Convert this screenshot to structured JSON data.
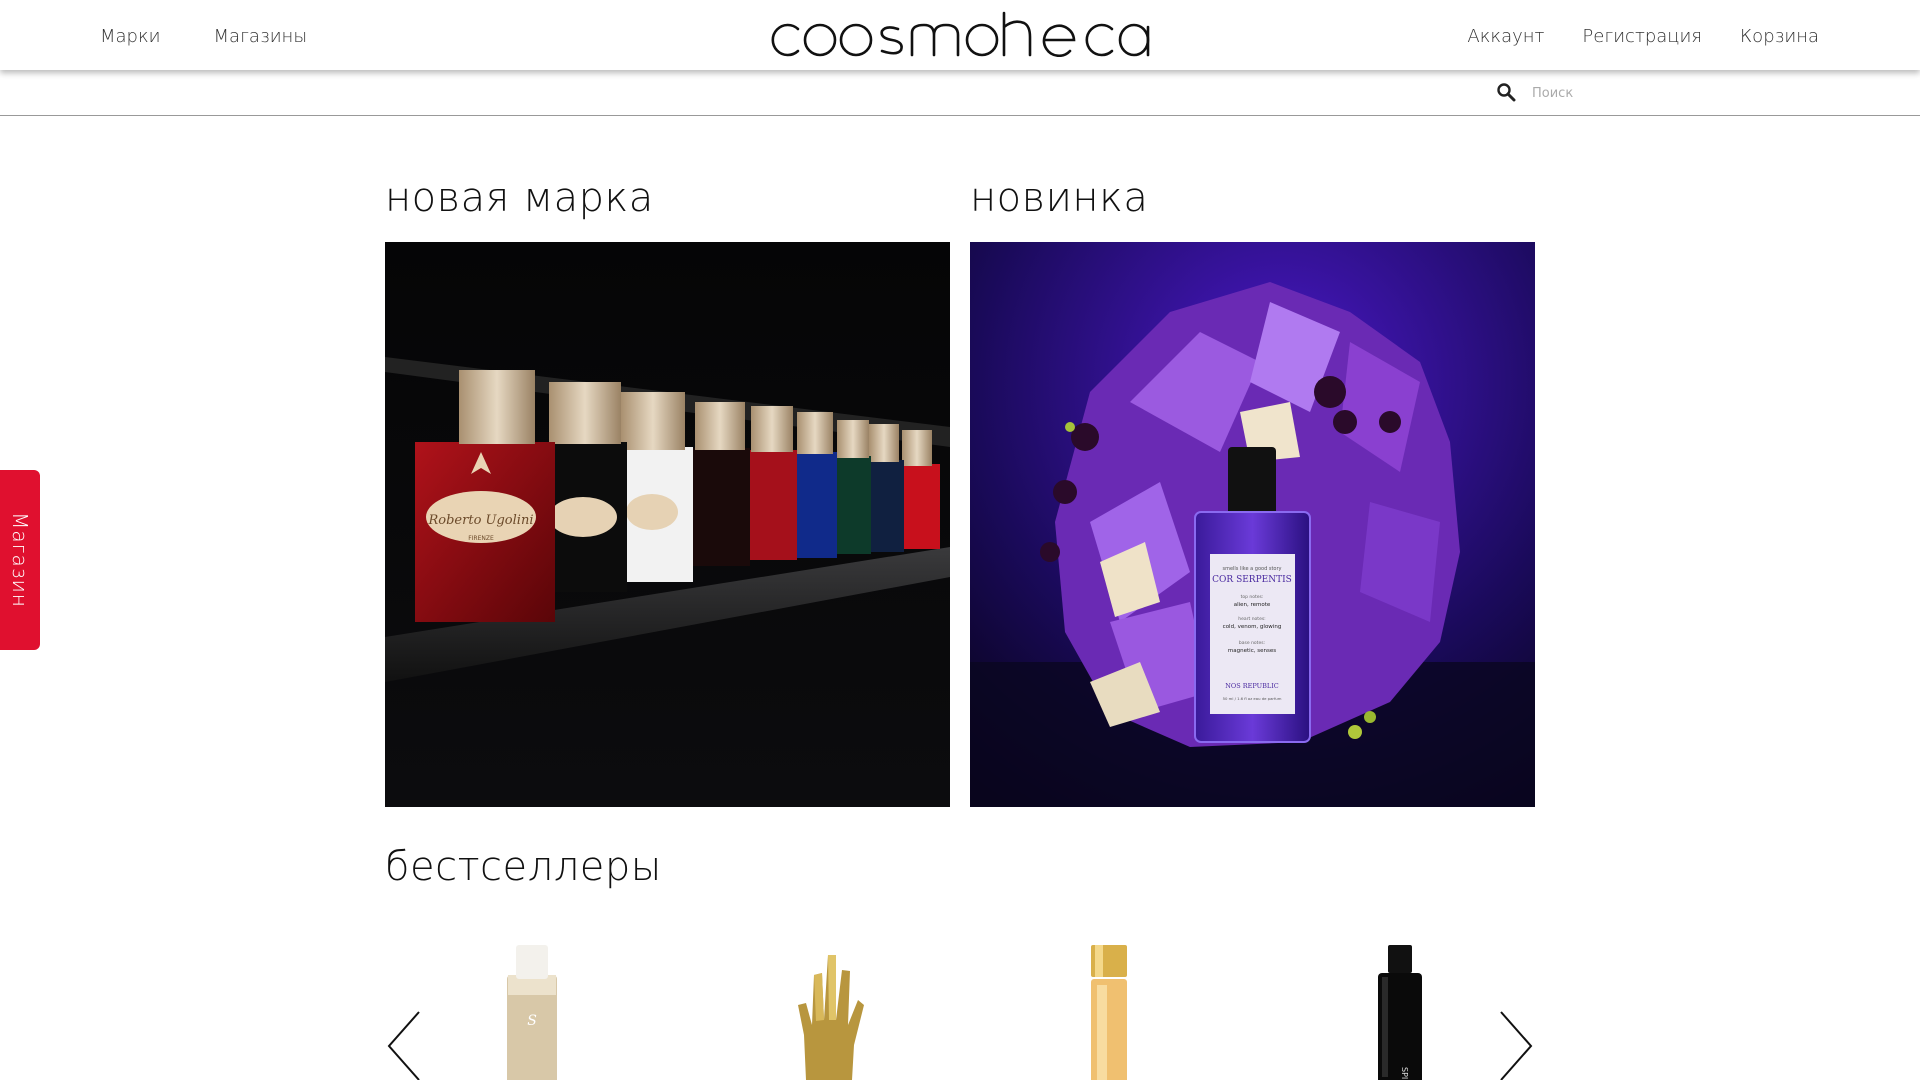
{
  "header": {
    "nav_left": [
      "Марки",
      "Магазины"
    ],
    "nav_right": [
      "Аккаунт",
      "Регистрация",
      "Корзина"
    ],
    "logo_text": "cosmotheca"
  },
  "search": {
    "placeholder": "Поиск"
  },
  "side_tab": {
    "label": "Магазин",
    "color": "#e0102f"
  },
  "sections": {
    "new_brand": {
      "title": "новая марка"
    },
    "new_item": {
      "title": "новинка",
      "bottle_label": {
        "tagline": "smells like a good story",
        "name": "COR SERPENTIS",
        "top_notes_label": "top notes:",
        "top_notes": "alien, remote",
        "heart_notes_label": "heart notes:",
        "heart_notes": "cold, venom, glowing",
        "base_notes_label": "base notes:",
        "base_notes": "magnetic, senses",
        "brand": "NOS REPUBLIC",
        "volume": "50 ml / 1.6 fl oz eau de parfum"
      }
    },
    "bestsellers": {
      "title": "бестселлеры"
    }
  },
  "left_promo": {
    "label_script": "Roberto Ugolini",
    "label_city": "FIRENZE"
  },
  "colors": {
    "accent": "#e0102f",
    "amethyst": "#5a1fa8"
  }
}
